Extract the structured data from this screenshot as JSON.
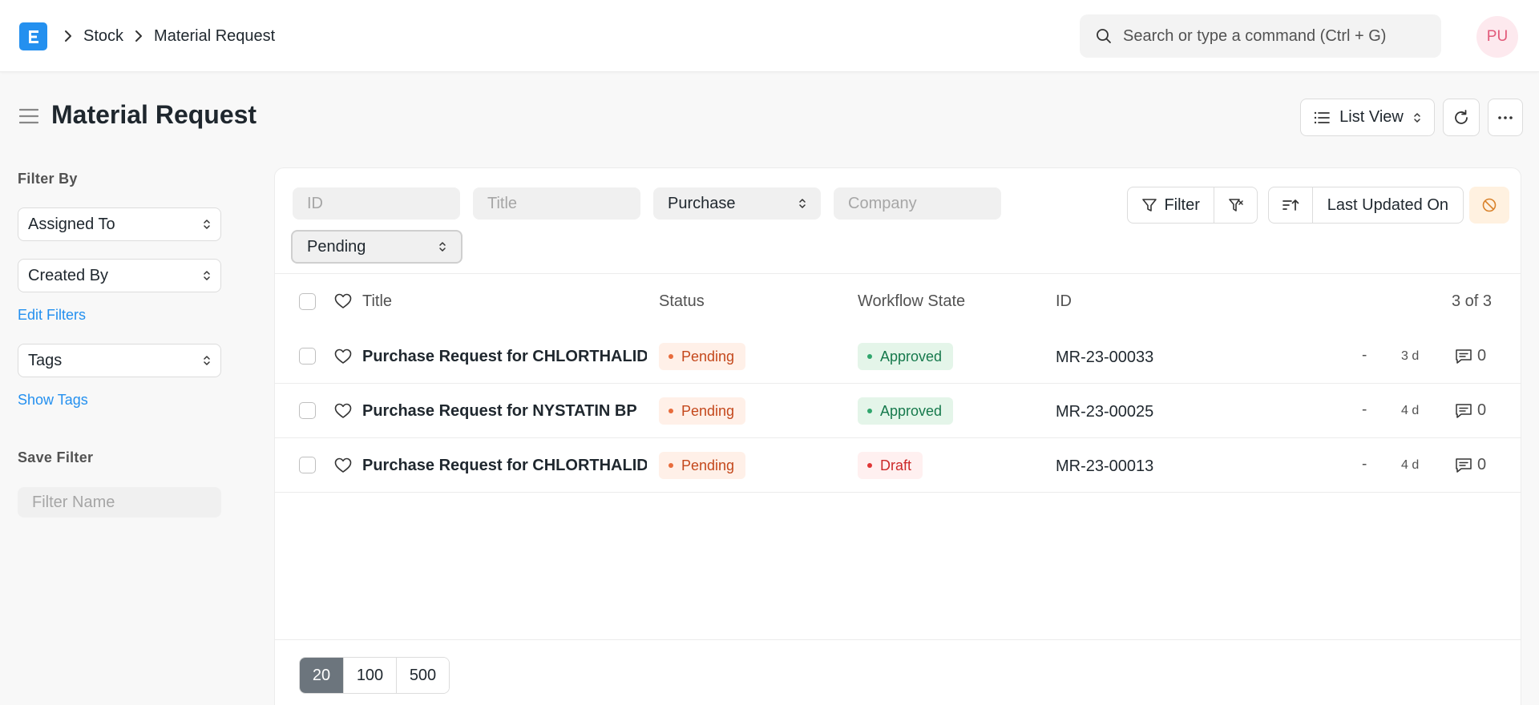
{
  "breadcrumb": {
    "items": [
      "Stock",
      "Material Request"
    ]
  },
  "search": {
    "placeholder": "Search or type a command (Ctrl + G)"
  },
  "user": {
    "initials": "PU"
  },
  "page": {
    "title": "Material Request"
  },
  "toolbar": {
    "list_view_label": "List View"
  },
  "sidebar": {
    "filter_by_label": "Filter By",
    "assigned_to": "Assigned To",
    "created_by": "Created By",
    "edit_filters": "Edit Filters",
    "tags": "Tags",
    "show_tags": "Show Tags",
    "save_filter_label": "Save Filter",
    "filter_name_placeholder": "Filter Name"
  },
  "filters": {
    "id_placeholder": "ID",
    "title_placeholder": "Title",
    "type_value": "Purchase",
    "company_placeholder": "Company",
    "status_value": "Pending",
    "filter_label": "Filter",
    "sort_label": "Last Updated On"
  },
  "table": {
    "headers": {
      "title": "Title",
      "status": "Status",
      "workflow_state": "Workflow State",
      "id": "ID",
      "count": "3 of 3"
    },
    "rows": [
      {
        "title": "Purchase Request for CHLORTHALIDONE",
        "status": "Pending",
        "workflow_state": "Approved",
        "id": "MR-23-00033",
        "dash": "-",
        "modified": "3 d",
        "comments": "0"
      },
      {
        "title": "Purchase Request for NYSTATIN BP",
        "status": "Pending",
        "workflow_state": "Approved",
        "id": "MR-23-00025",
        "dash": "-",
        "modified": "4 d",
        "comments": "0"
      },
      {
        "title": "Purchase Request for CHLORTHALIDONE",
        "status": "Pending",
        "workflow_state": "Draft",
        "id": "MR-23-00013",
        "dash": "-",
        "modified": "4 d",
        "comments": "0"
      }
    ]
  },
  "pagination": {
    "sizes": [
      "20",
      "100",
      "500"
    ],
    "active": "20"
  },
  "colors": {
    "accent": "#2490ef",
    "pending": "#c4481c",
    "approved": "#16794c",
    "draft": "#cc2929"
  }
}
